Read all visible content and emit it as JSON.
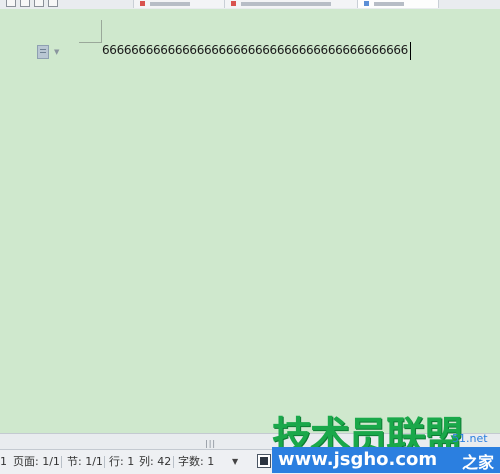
{
  "document": {
    "text": "666666666666666666666666666666666666666666"
  },
  "statusbar": {
    "page_no": "1",
    "page": "页面: 1/1",
    "section": "节: 1/1",
    "line": "行: 1",
    "column": "列: 42",
    "word_count": "字数: 1"
  },
  "scrollbar": {
    "grip": "|||"
  },
  "watermark": {
    "title": "技术员联盟",
    "url": "www.jsgho.com",
    "side": "51.net",
    "tail": "之家"
  },
  "colors": {
    "canvas": "#cfe8cd",
    "watermark_green": "#1aa84a",
    "watermark_blue": "#2b7fe0"
  },
  "icons": [
    "paragraph-icon",
    "full-screen-icon",
    "view-mode-icon"
  ]
}
